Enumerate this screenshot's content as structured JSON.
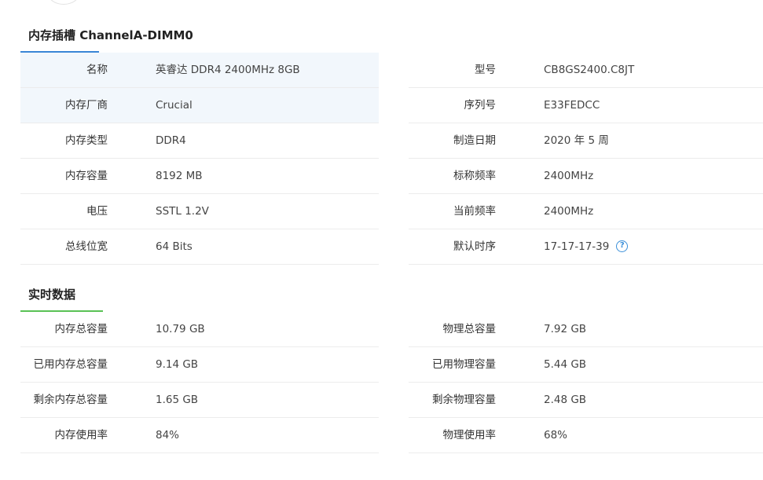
{
  "slot": {
    "title": "内存插槽 ChannelA-DIMM0",
    "left": [
      {
        "label": "名称",
        "value": "英睿达 DDR4 2400MHz 8GB"
      },
      {
        "label": "内存厂商",
        "value": "Crucial"
      },
      {
        "label": "内存类型",
        "value": "DDR4"
      },
      {
        "label": "内存容量",
        "value": "8192 MB"
      },
      {
        "label": "电压",
        "value": "SSTL 1.2V"
      },
      {
        "label": "总线位宽",
        "value": "64 Bits"
      }
    ],
    "right": [
      {
        "label": "型号",
        "value": "CB8GS2400.C8JT"
      },
      {
        "label": "序列号",
        "value": "E33FEDCC"
      },
      {
        "label": "制造日期",
        "value": "2020 年 5 周"
      },
      {
        "label": "标称频率",
        "value": "2400MHz"
      },
      {
        "label": "当前频率",
        "value": "2400MHz"
      },
      {
        "label": "默认时序",
        "value": "17-17-17-39"
      }
    ],
    "help_glyph": "?"
  },
  "realtime": {
    "title": "实时数据",
    "left": [
      {
        "label": "内存总容量",
        "value": "10.79 GB"
      },
      {
        "label": "已用内存总容量",
        "value": "9.14 GB"
      },
      {
        "label": "剩余内存总容量",
        "value": "1.65 GB"
      },
      {
        "label": "内存使用率",
        "value": "84%"
      }
    ],
    "right": [
      {
        "label": "物理总容量",
        "value": "7.92 GB"
      },
      {
        "label": "已用物理容量",
        "value": "5.44 GB"
      },
      {
        "label": "剩余物理容量",
        "value": "2.48 GB"
      },
      {
        "label": "物理使用率",
        "value": "68%"
      }
    ]
  },
  "colors": {
    "accent_blue": "#3a86d6",
    "accent_green": "#59c255",
    "highlight_row": "#f2f7fc"
  }
}
